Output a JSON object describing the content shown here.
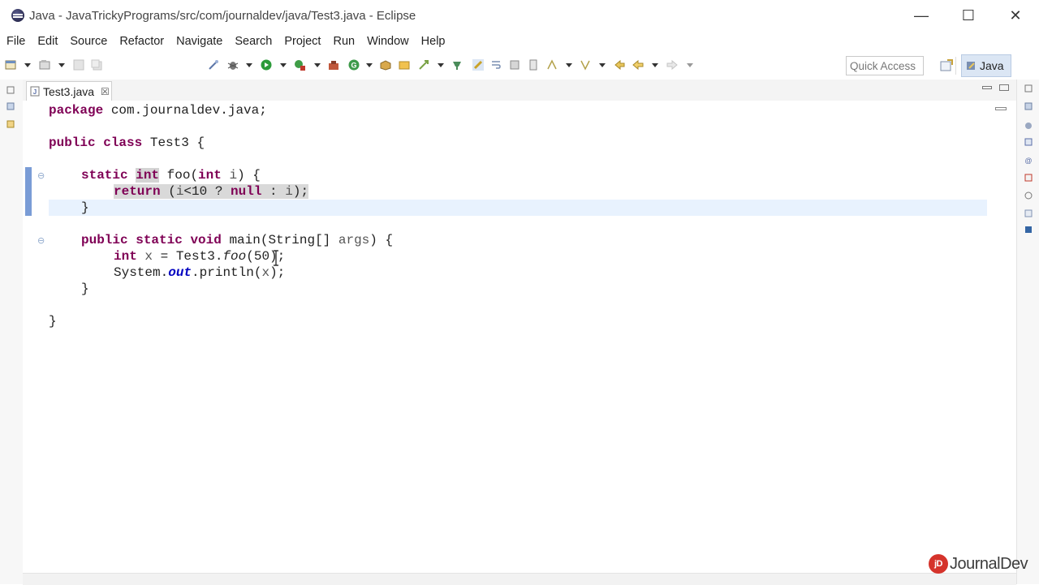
{
  "window": {
    "title": "Java - JavaTrickyPrograms/src/com/journaldev/java/Test3.java - Eclipse",
    "minimize_glyph": "—",
    "maximize_glyph": "☐",
    "close_glyph": "✕"
  },
  "menu": [
    "File",
    "Edit",
    "Source",
    "Refactor",
    "Navigate",
    "Search",
    "Project",
    "Run",
    "Window",
    "Help"
  ],
  "toolbar": {
    "quick_access_placeholder": "Quick Access",
    "perspective_label": "Java"
  },
  "editor": {
    "tab_label": "Test3.java",
    "tab_close_glyph": "☒",
    "fold_glyph": "⊖",
    "lines": {
      "l1_kw": "package",
      "l1_rest": " com.journaldev.java;",
      "l3_kw1": "public",
      "l3_kw2": "class",
      "l3_rest": " Test3 {",
      "l5_kw1": "static",
      "l5_kw2": "int",
      "l5_mid": " foo(",
      "l5_kw3": "int",
      "l5_var": " i",
      "l5_end": ") {",
      "l6_kw": "return",
      "l6_a": " (",
      "l6_var1": "i",
      "l6_b": "<10 ? ",
      "l6_kw2": "null",
      "l6_c": " : ",
      "l6_var2": "i",
      "l6_d": ");",
      "l7": "}",
      "l9_kw1": "public",
      "l9_kw2": "static",
      "l9_kw3": "void",
      "l9_mid": " main(String[] ",
      "l9_var": "args",
      "l9_end": ") {",
      "l10_kw": "int",
      "l10_var": " x",
      "l10_a": " = Test3.",
      "l10_call": "foo",
      "l10_b": "(50);",
      "l11_a": "System.",
      "l11_field": "out",
      "l11_b": ".println(",
      "l11_var": "x",
      "l11_c": ");",
      "l12": "}",
      "l14": "}"
    }
  },
  "watermark": {
    "logo_text": "jD",
    "brand": "JournalDev"
  },
  "colors": {
    "keyword": "#7f0055",
    "static_field": "#0000c0",
    "current_line": "#e8f2fe",
    "perspective_active": "#dbe6f4",
    "change_bar": "#7a9cd6"
  }
}
